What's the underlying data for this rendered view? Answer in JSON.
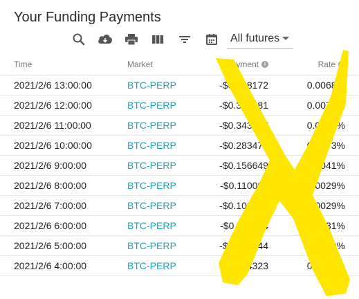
{
  "title": "Your Funding Payments",
  "toolbar": {
    "icons": [
      "search-icon",
      "download-icon",
      "print-icon",
      "columns-icon",
      "filter-icon",
      "calendar-icon"
    ],
    "filter_select": {
      "value": "All futures"
    }
  },
  "table": {
    "headers": {
      "time": "Time",
      "market": "Market",
      "payment": "Payment",
      "rate": "Rate"
    },
    "rows": [
      {
        "time": "2021/2/6 13:00:00",
        "market": "BTC-PERP",
        "payment": "-$0.268172",
        "rate": "0.0068%"
      },
      {
        "time": "2021/2/6 12:00:00",
        "market": "BTC-PERP",
        "payment": "-$0.304081",
        "rate": "0.0077%"
      },
      {
        "time": "2021/2/6 11:00:00",
        "market": "BTC-PERP",
        "payment": "-$0.343367",
        "rate": "0.0088%"
      },
      {
        "time": "2021/2/6 10:00:00",
        "market": "BTC-PERP",
        "payment": "-$0.283474",
        "rate": "0.0073%"
      },
      {
        "time": "2021/2/6 9:00:00",
        "market": "BTC-PERP",
        "payment": "-$0.156649",
        "rate": "0.0041%"
      },
      {
        "time": "2021/2/6 8:00:00",
        "market": "BTC-PERP",
        "payment": "-$0.110003",
        "rate": "0.0029%"
      },
      {
        "time": "2021/2/6 7:00:00",
        "market": "BTC-PERP",
        "payment": "-$0.109864",
        "rate": "0.0029%"
      },
      {
        "time": "2021/2/6 6:00:00",
        "market": "BTC-PERP",
        "payment": "-$0.117174",
        "rate": "0.0031%"
      },
      {
        "time": "2021/2/6 5:00:00",
        "market": "BTC-PERP",
        "payment": "-$0.150744",
        "rate": "0.0040%"
      },
      {
        "time": "2021/2/6 4:00:00",
        "market": "BTC-PERP",
        "payment": "-$0.184323",
        "rate": "0.0049%"
      }
    ]
  },
  "colors": {
    "market_link": "#1aa3b4",
    "overlay_mark": "#ffe600"
  }
}
